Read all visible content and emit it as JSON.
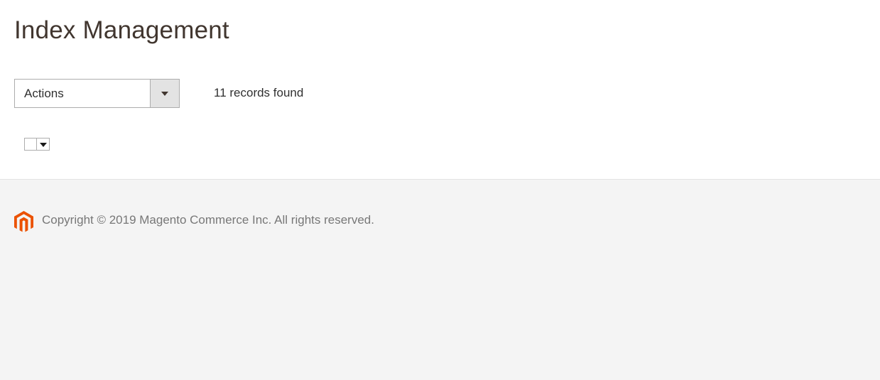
{
  "page": {
    "title": "Index Management"
  },
  "toolbar": {
    "actions_label": "Actions",
    "records_found": "11 records found"
  },
  "mass_select": {
    "checked": false
  },
  "footer": {
    "copyright": "Copyright © 2019 Magento Commerce Inc. All rights reserved.",
    "logo_icon": "magento-logo-icon",
    "logo_color": "#eb5202"
  }
}
